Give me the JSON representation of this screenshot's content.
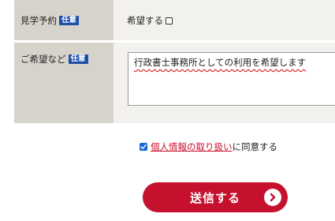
{
  "form": {
    "visit": {
      "label": "見学予約",
      "badge": "任意",
      "option_label": "希望する",
      "checked": false
    },
    "request": {
      "label": "ご希望など",
      "badge": "任意",
      "value": "行政書士事務所としての利用を希望します"
    },
    "consent": {
      "checked": true,
      "link_text": "個人情報の取り扱い",
      "suffix_text": "に同意する"
    },
    "submit": {
      "label": "送信する",
      "icon": "chevron-right-icon"
    }
  },
  "colors": {
    "label_bg": "#d6d3ca",
    "value_bg": "#f2f1ee",
    "badge_bg": "#1f4fa8",
    "accent_red": "#c5112e",
    "link_red": "#c8102e",
    "checkbox_blue": "#1a66d2"
  }
}
